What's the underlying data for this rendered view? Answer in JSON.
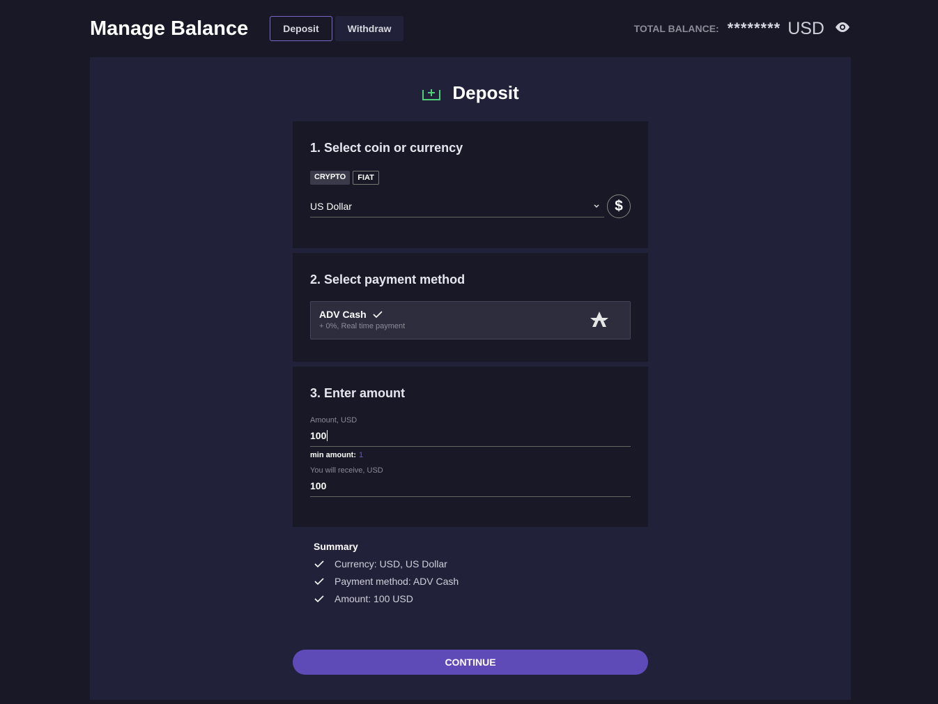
{
  "header": {
    "title": "Manage Balance",
    "tabs": [
      {
        "label": "Deposit",
        "active": true
      },
      {
        "label": "Withdraw",
        "active": false
      }
    ],
    "balance_label": "TOTAL BALANCE:",
    "balance_masked": "********",
    "balance_currency": "USD",
    "eye_icon": "eye-icon"
  },
  "deposit": {
    "title": "Deposit",
    "icon": "deposit-tray-icon",
    "accent": "#4fd17a"
  },
  "step1": {
    "title": "1. Select coin or currency",
    "chips": [
      "CRYPTO",
      "FIAT"
    ],
    "selected_currency": "US Dollar",
    "currency_symbol": "$"
  },
  "step2": {
    "title": "2. Select payment method",
    "method": {
      "name": "ADV Cash",
      "desc": "+ 0%, Real time payment",
      "selected": true
    }
  },
  "step3": {
    "title": "3. Enter amount",
    "amount_label": "Amount, USD",
    "amount_value": "100",
    "min_label": "min amount:",
    "min_value": "1",
    "receive_label": "You will receive, USD",
    "receive_value": "100"
  },
  "summary": {
    "title": "Summary",
    "items": [
      "Currency: USD, US Dollar",
      "Payment method: ADV Cash",
      "Amount: 100 USD"
    ]
  },
  "continue_label": "CONTINUE",
  "colors": {
    "background": "#181826",
    "panel": "#21213a",
    "primary": "#5f4bb8"
  }
}
